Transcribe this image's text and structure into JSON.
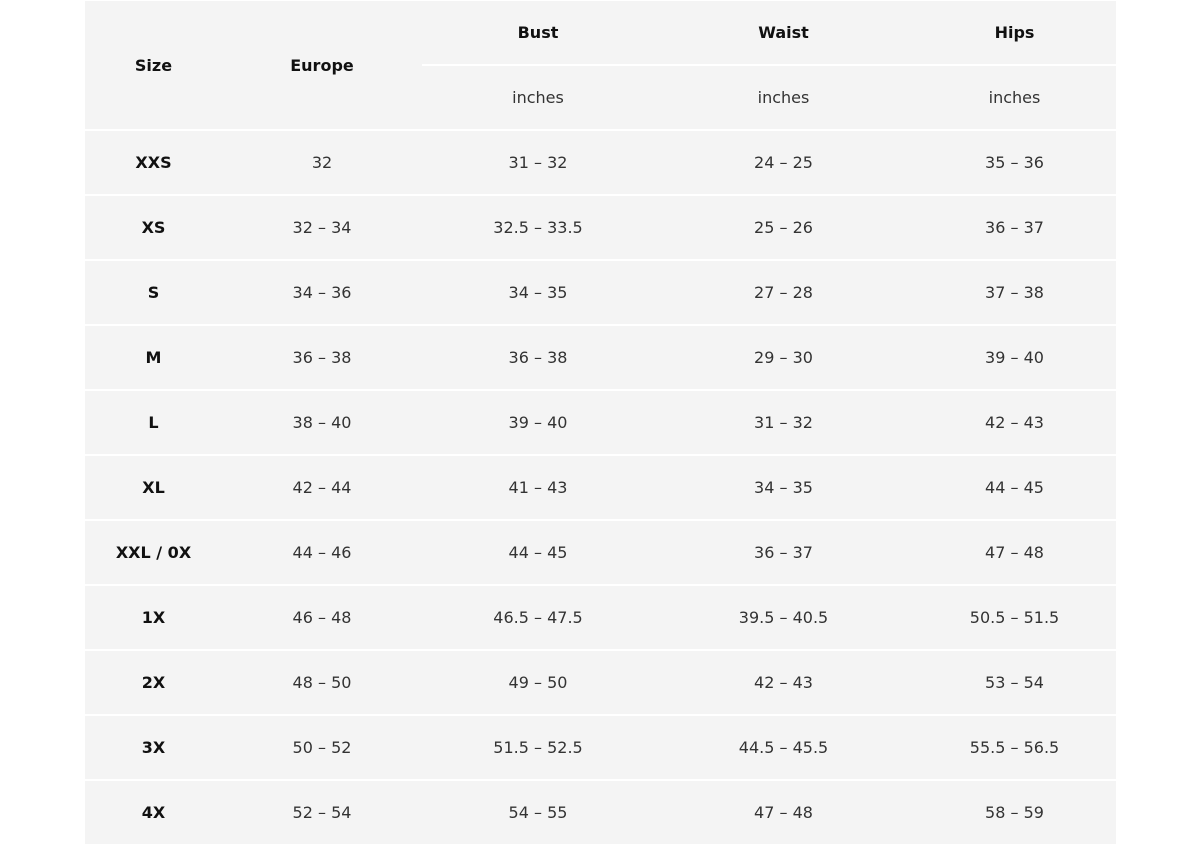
{
  "table": {
    "headers": {
      "size": "Size",
      "europe": "Europe",
      "bust": "Bust",
      "waist": "Waist",
      "hips": "Hips"
    },
    "units": {
      "bust": "inches",
      "waist": "inches",
      "hips": "inches"
    },
    "rows": [
      {
        "size": "XXS",
        "europe": "32",
        "bust": "31 – 32",
        "waist": "24 – 25",
        "hips": "35 – 36"
      },
      {
        "size": "XS",
        "europe": "32 – 34",
        "bust": "32.5 – 33.5",
        "waist": "25 – 26",
        "hips": "36 – 37"
      },
      {
        "size": "S",
        "europe": "34 – 36",
        "bust": "34 – 35",
        "waist": "27 – 28",
        "hips": "37 – 38"
      },
      {
        "size": "M",
        "europe": "36 – 38",
        "bust": "36 – 38",
        "waist": "29 – 30",
        "hips": "39 – 40"
      },
      {
        "size": "L",
        "europe": "38 – 40",
        "bust": "39 – 40",
        "waist": "31 – 32",
        "hips": "42 – 43"
      },
      {
        "size": "XL",
        "europe": "42 – 44",
        "bust": "41 – 43",
        "waist": "34 – 35",
        "hips": "44 – 45"
      },
      {
        "size": "XXL / 0X",
        "europe": "44 – 46",
        "bust": "44 – 45",
        "waist": "36 – 37",
        "hips": "47 – 48"
      },
      {
        "size": "1X",
        "europe": "46 – 48",
        "bust": "46.5 – 47.5",
        "waist": "39.5 – 40.5",
        "hips": "50.5 – 51.5"
      },
      {
        "size": "2X",
        "europe": "48 – 50",
        "bust": "49 – 50",
        "waist": "42 – 43",
        "hips": "53 – 54"
      },
      {
        "size": "3X",
        "europe": "50 – 52",
        "bust": "51.5 – 52.5",
        "waist": "44.5 – 45.5",
        "hips": "55.5 – 56.5"
      },
      {
        "size": "4X",
        "europe": "52 – 54",
        "bust": "54 – 55",
        "waist": "47 – 48",
        "hips": "58 – 59"
      }
    ]
  }
}
